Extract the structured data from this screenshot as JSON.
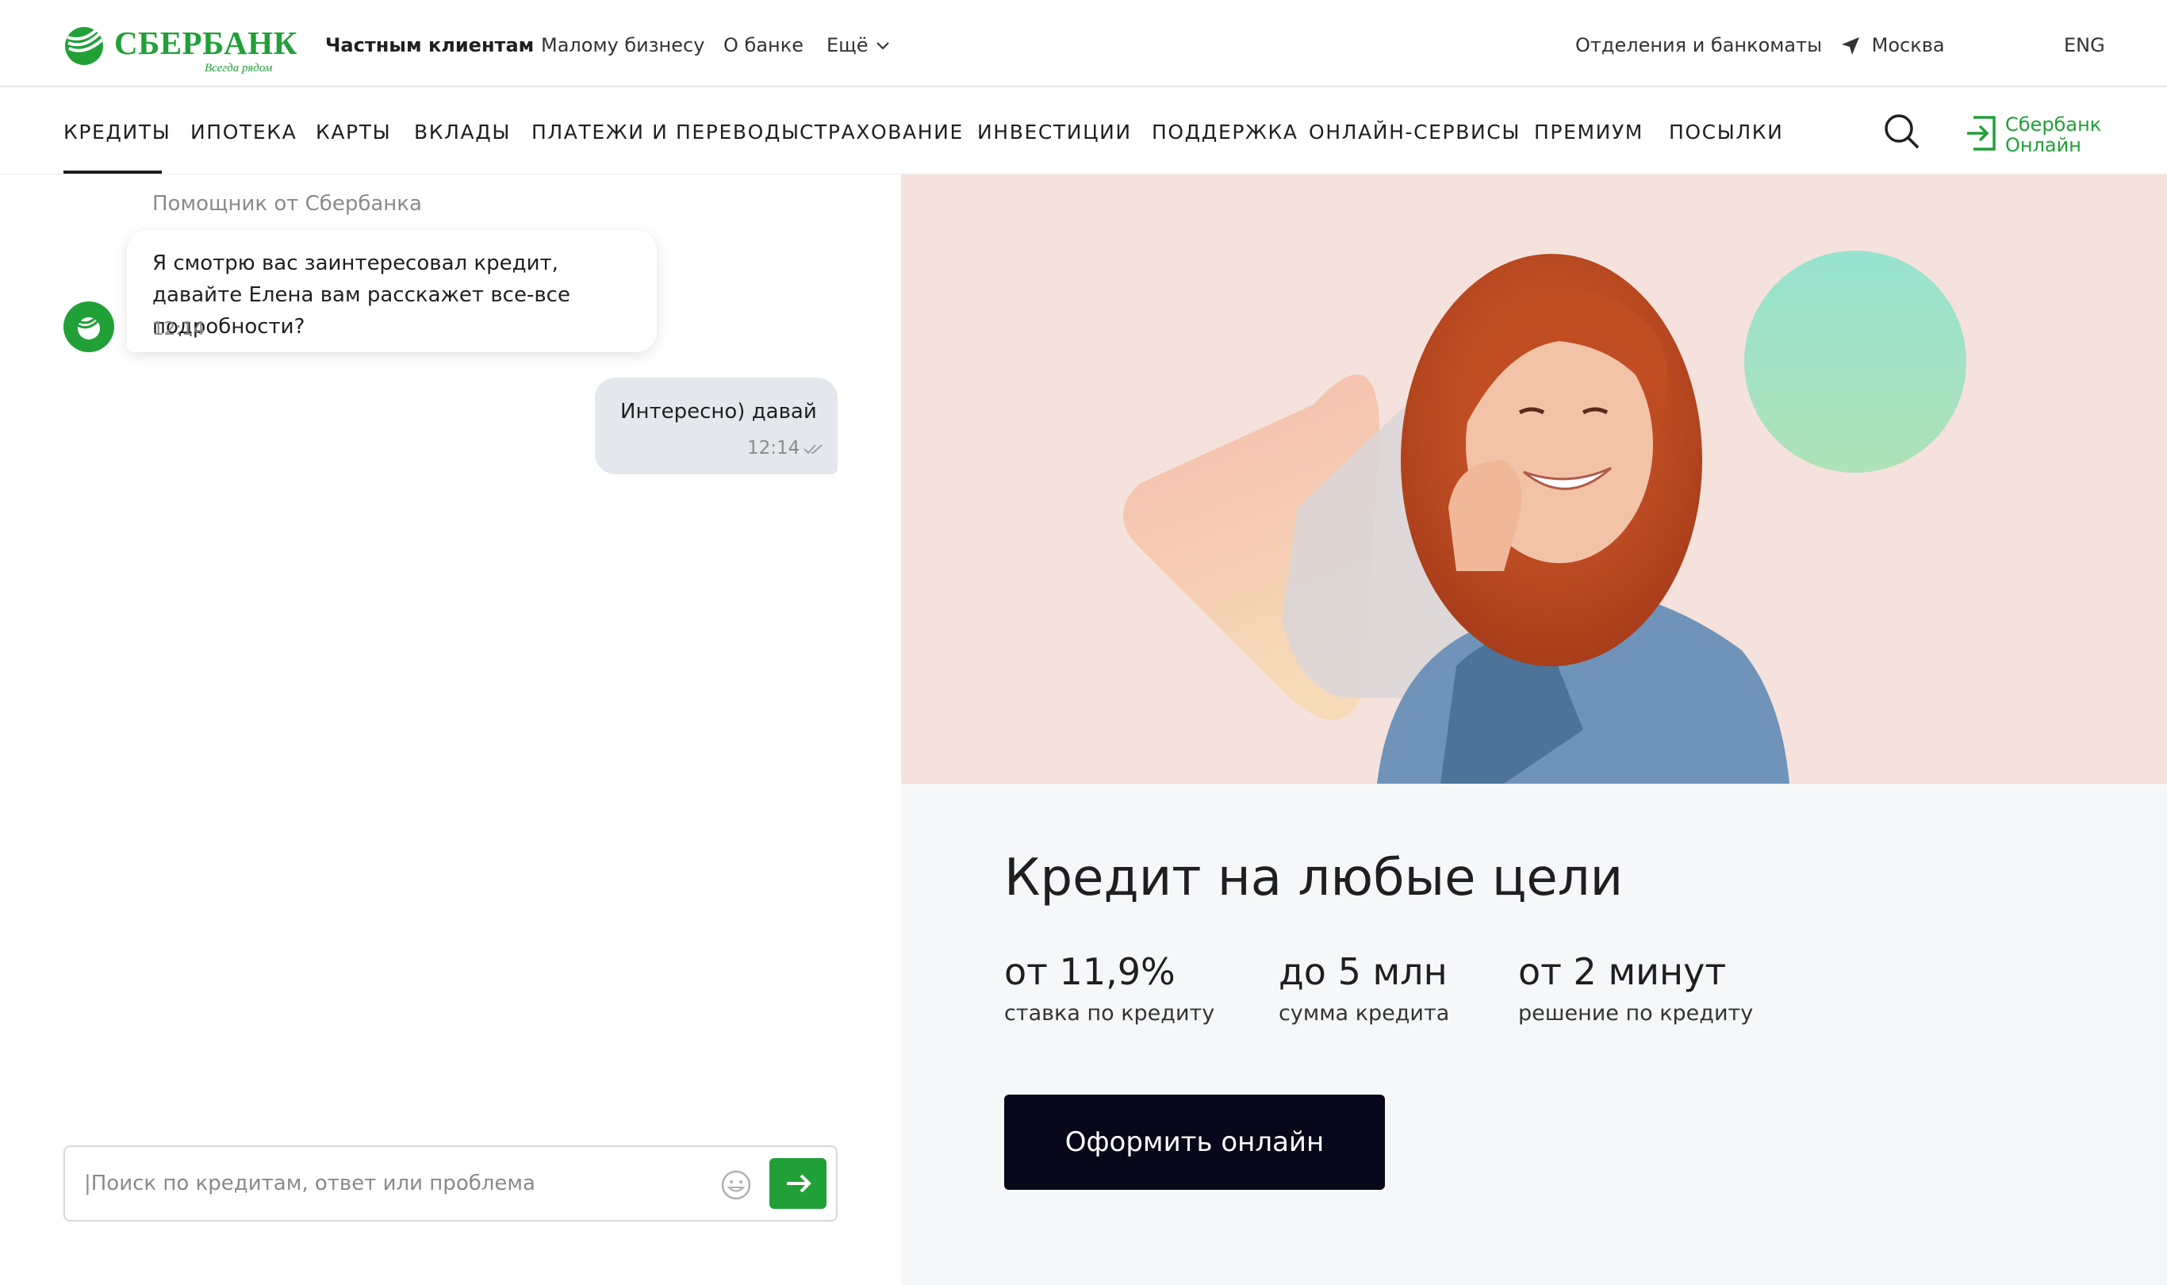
{
  "brand": {
    "name": "СБЕРБАНК",
    "tagline": "Всегда рядом",
    "color": "#21a038"
  },
  "topbar": {
    "segments": [
      "Частным клиентам",
      "Малому бизнесу",
      "О банке",
      "Ещё"
    ],
    "active_segment": "Частным клиентам",
    "branches": "Отделения и банкоматы",
    "city": "Москва",
    "lang": "ENG"
  },
  "nav": {
    "items": [
      "КРЕДИТЫ",
      "ИПОТЕКА",
      "КАРТЫ",
      "ВКЛАДЫ",
      "ПЛАТЕЖИ И ПЕРЕВОДЫ",
      "СТРАХОВАНИЕ",
      "ИНВЕСТИЦИИ",
      "ПОДДЕРЖКА",
      "ОНЛАЙН-СЕРВИСЫ",
      "ПРЕМИУМ",
      "ПОСЫЛКИ"
    ],
    "active": "КРЕДИТЫ",
    "online_line1": "Сбербанк",
    "online_line2": "Онлайн"
  },
  "chat": {
    "assistant_name": "Помощник от Сбербанка",
    "messages": [
      {
        "from": "bot",
        "text": "Я смотрю вас заинтересовал кредит, давайте Елена вам расскажет все-все подробности?",
        "time": "12:14"
      },
      {
        "from": "user",
        "text": "Интересно) давай",
        "time": "12:14"
      }
    ],
    "input_placeholder": "|Поиск по кредитам, ответ или проблема",
    "input_value": ""
  },
  "offer": {
    "title": "Кредит на любые цели",
    "stats": [
      {
        "value": "от 11,9%",
        "label": "ставка по кредиту"
      },
      {
        "value": "до 5 млн",
        "label": "сумма кредита"
      },
      {
        "value": "от 2 минут",
        "label": "решение по кредиту"
      }
    ],
    "cta": "Оформить онлайн"
  },
  "colors": {
    "hero_bg": "#f5e2dc",
    "offer_bg": "#f6f7f9",
    "cta_bg": "#08081a",
    "user_bubble": "#e4e8ed"
  },
  "icons": [
    "sber-logo-icon",
    "chevron-down-icon",
    "location-arrow-icon",
    "search-icon",
    "login-icon",
    "bot-avatar-icon",
    "double-check-icon",
    "emoji-icon",
    "arrow-right-icon"
  ]
}
